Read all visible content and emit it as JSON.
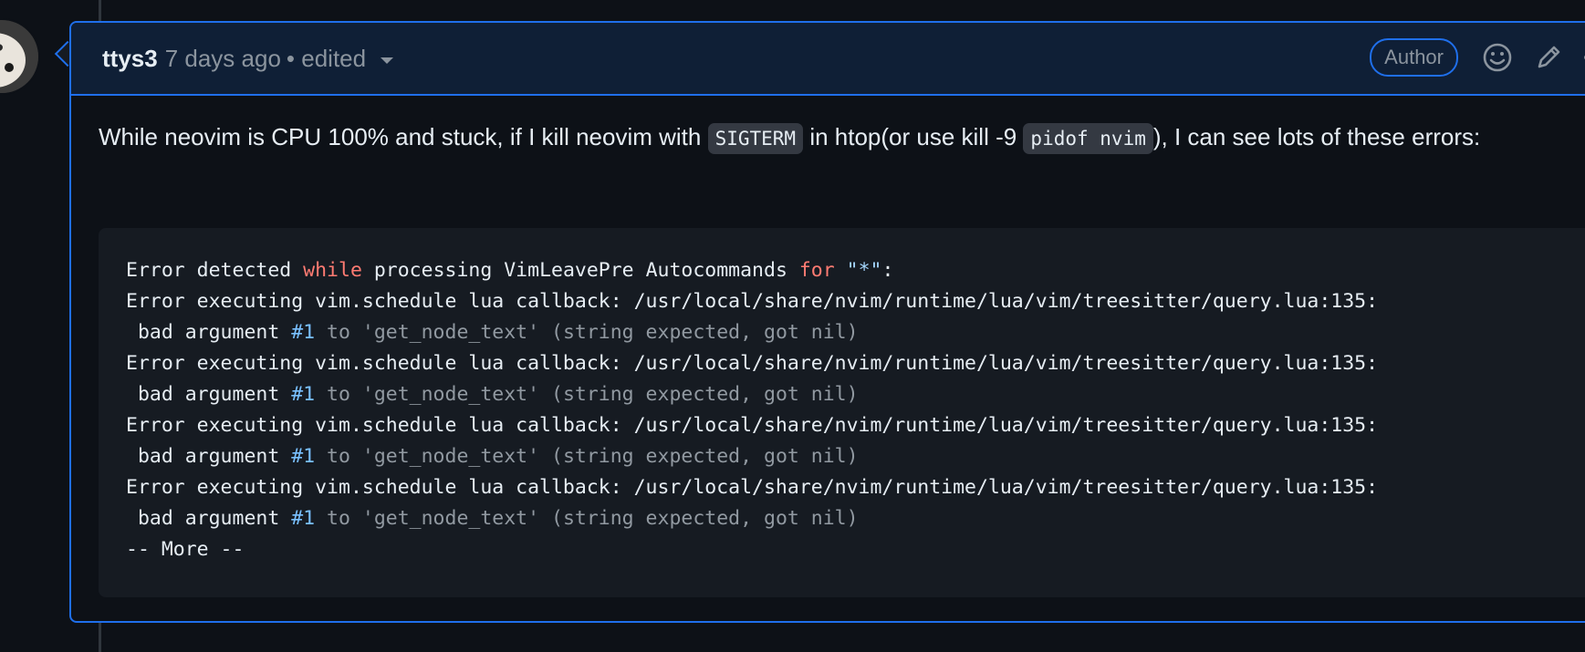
{
  "comment": {
    "author": "ttys3",
    "time": "7 days ago",
    "edited": "• edited",
    "badge": "Author",
    "body": {
      "t1": "While neovim is CPU 100% and stuck, if I kill neovim with ",
      "code1": "SIGTERM",
      "t2": " in htop(or use kill -9 ",
      "code2": "pidof nvim",
      "t3": "), I can see lots of these errors:"
    },
    "code_block": {
      "line0": {
        "a": "Error detected ",
        "kw1": "while",
        "b": " processing VimLeavePre Autocommands ",
        "kw2": "for",
        "c": " ",
        "str": "\"*\"",
        "d": ":"
      },
      "error_line": "Error executing vim.schedule lua callback: /usr/local/share/nvim/runtime/lua/vim/treesitter/query.lua:135:",
      "bad_prefix": " bad argument ",
      "bad_num": "#1",
      "bad_to": " to ",
      "bad_str": "'get_node_text'",
      "bad_rest": " (string expected, got nil)",
      "more": "-- More --"
    }
  },
  "icons": [
    "avatar",
    "chevron-down-icon",
    "smiley-icon",
    "pencil-icon",
    "kebab-horizontal-icon"
  ]
}
